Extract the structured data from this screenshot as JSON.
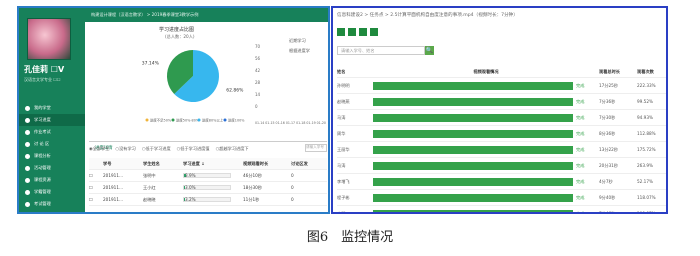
{
  "left": {
    "profile": {
      "name": "孔佳莉 ☐V",
      "subtitle": "汉语言文学专业 ☐☐"
    },
    "topbar": "构建设计课程（汉语言教学） > 2019春季课堂3教学示例",
    "sidebar": [
      {
        "label": "我的学堂",
        "active": false
      },
      {
        "label": "学习进度",
        "active": true
      },
      {
        "label": "作业考试",
        "active": false
      },
      {
        "label": "讨 论 区",
        "active": false
      },
      {
        "label": "课程分析",
        "active": false
      },
      {
        "label": "活动管理",
        "active": false
      },
      {
        "label": "课程资源",
        "active": false
      },
      {
        "label": "学籍管理",
        "active": false
      },
      {
        "label": "考试管理",
        "active": false
      },
      {
        "label": "...",
        "active": false
      }
    ],
    "chart_data": {
      "type": "pie",
      "title": "学习进度占比图",
      "subtitle": "(总人数：20人)",
      "slices": [
        {
          "name": "进度不足50%",
          "value": 62.86,
          "color": "#37b7ee"
        },
        {
          "name": "进度50%-80%",
          "value": 37.14,
          "color": "#2f9a4f"
        }
      ],
      "slice_labels": [
        "62.86%",
        "37.14%"
      ],
      "legend": [
        "进度不足50%",
        "进度50%-80%",
        "进度80%以上",
        "进度100%"
      ],
      "legend_colors": [
        "#f0b43a",
        "#2f9a4f",
        "#37b7ee",
        "#2a6fd6"
      ],
      "y_ticks": [
        "70",
        "56",
        "42",
        "28",
        "14",
        "0"
      ],
      "x_ticks": "01-14 01-15 01-16 01-17 01-18 01-19 01-20",
      "right_labels": [
        "近期学习",
        "根据进度学"
      ]
    },
    "tab_title": "进度详情",
    "filters": [
      "全部学生",
      "没有学习",
      "低于学习进度",
      "低于学习进度值",
      "超越学习进度下"
    ],
    "search_placeholder": "请输入学号",
    "table": {
      "headers": [
        "",
        "学号",
        "学生姓名",
        "学习进度 ↓",
        "视频观看时长",
        "讨论区发"
      ],
      "rows": [
        {
          "id": "201911...",
          "name": "张明中",
          "progress": 3.9,
          "progress_label": "3.9%",
          "time": "46分10秒",
          "posts": "0"
        },
        {
          "id": "201911...",
          "name": "王小红",
          "progress": 3.0,
          "progress_label": "3.0%",
          "time": "18分30秒",
          "posts": "0"
        },
        {
          "id": "201911...",
          "name": "赵晓晓",
          "progress": 3.2,
          "progress_label": "3.2%",
          "time": "11分1秒",
          "posts": "0"
        }
      ]
    }
  },
  "right": {
    "breadcrumb": "信息科建设2 > 任务点 > 2.5计算平面机构自由度注意的事项.mp4（视频时长：7分钟）",
    "search_placeholder": "请输入学号、姓名",
    "search_button": "🔍",
    "headers": [
      "姓名",
      "视频观看情况",
      "观看总时长",
      "观看次数"
    ],
    "rows": [
      {
        "name": "孙明明",
        "progress": 100,
        "status": "完成",
        "total": "17分25秒",
        "ratio": "222.33%"
      },
      {
        "name": "赵晓燕",
        "progress": 100,
        "status": "完成",
        "total": "7分36秒",
        "ratio": "99.52%"
      },
      {
        "name": "马涛",
        "progress": 100,
        "status": "完成",
        "total": "7分30秒",
        "ratio": "94.93%"
      },
      {
        "name": "周华",
        "progress": 100,
        "status": "完成",
        "total": "8分36秒",
        "ratio": "112.88%"
      },
      {
        "name": "王丽华",
        "progress": 100,
        "status": "完成",
        "total": "13分22秒",
        "ratio": "175.72%"
      },
      {
        "name": "马涛",
        "progress": 100,
        "status": "完成",
        "total": "20分31秒",
        "ratio": "263.9%"
      },
      {
        "name": "李增飞",
        "progress": 100,
        "status": "完成",
        "total": "4分7秒",
        "ratio": "52.17%"
      },
      {
        "name": "程子彬",
        "progress": 100,
        "status": "完成",
        "total": "9分40秒",
        "ratio": "118.07%"
      },
      {
        "name": "李明",
        "progress": 100,
        "status": "完成",
        "total": "7分46秒",
        "ratio": "100.07%"
      }
    ]
  },
  "caption": "图6　监控情况"
}
